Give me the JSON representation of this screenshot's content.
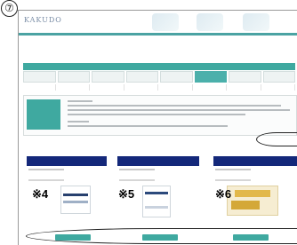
{
  "step_marker": "⑦",
  "header": {
    "logo": "KAKUDO",
    "sub": ""
  },
  "breadcrumb": "",
  "page_heading": [
    "",
    ""
  ],
  "page_right": "",
  "tabbar_title": "",
  "tabs": [
    {
      "label": "",
      "active": false
    },
    {
      "label": "",
      "active": false
    },
    {
      "label": "",
      "active": false
    },
    {
      "label": "",
      "active": false
    },
    {
      "label": "",
      "active": false
    },
    {
      "label": "",
      "active": true
    },
    {
      "label": "",
      "active": false
    },
    {
      "label": "",
      "active": false
    }
  ],
  "callout_text": "",
  "section_heading": [
    "",
    ""
  ],
  "columns": [
    {
      "button": "",
      "mark": "※4"
    },
    {
      "button": "",
      "mark": "※5"
    },
    {
      "button": "",
      "mark": "※6"
    }
  ],
  "bottom_buttons": [
    "",
    "",
    ""
  ],
  "colors": {
    "teal": "#3fa9a0",
    "navy": "#14287a"
  }
}
